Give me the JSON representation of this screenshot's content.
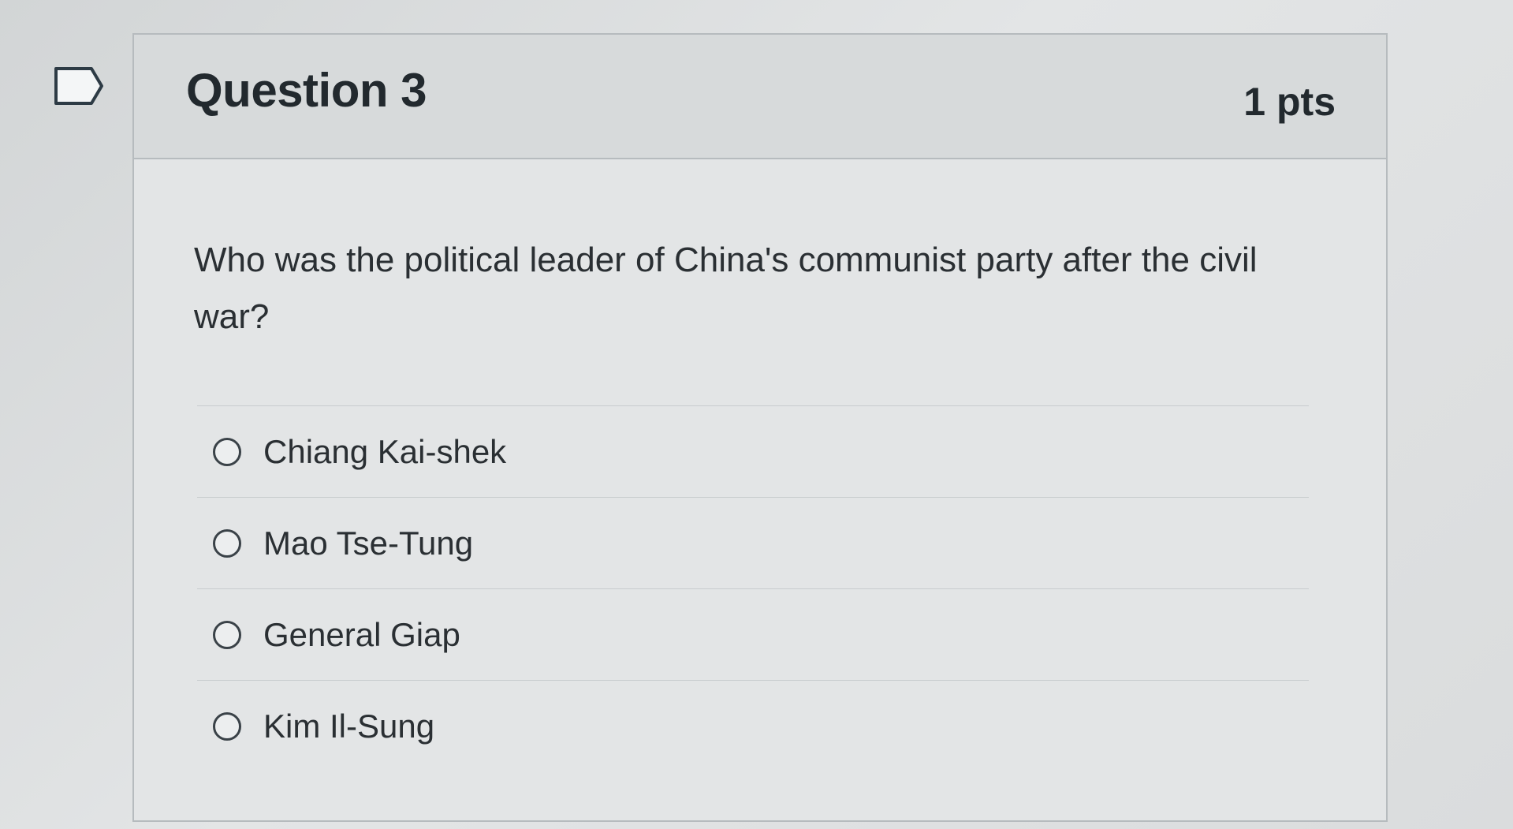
{
  "question": {
    "title": "Question 3",
    "points": "1 pts",
    "text": "Who was the political leader of China's communist party after the civil war?"
  },
  "answers": [
    {
      "label": "Chiang Kai-shek",
      "selected": false
    },
    {
      "label": "Mao Tse-Tung",
      "selected": false
    },
    {
      "label": "General Giap",
      "selected": false
    },
    {
      "label": "Kim Il-Sung",
      "selected": false
    }
  ],
  "colors": {
    "background": "#d9dcdd",
    "header": "#d7dadb",
    "border": "#b6bbbe",
    "text": "#22292e"
  },
  "icons": {
    "flag": "flag-icon",
    "radio": "radio-icon"
  }
}
